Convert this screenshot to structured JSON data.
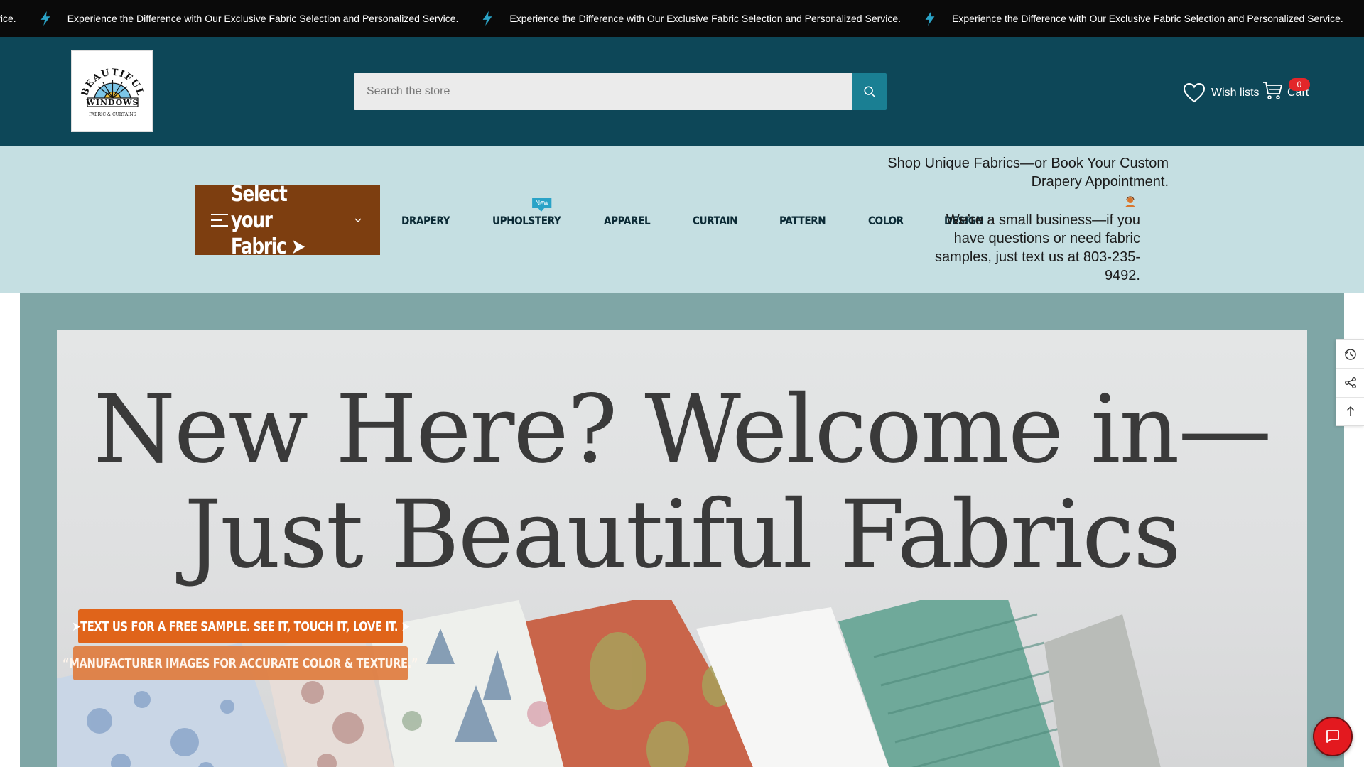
{
  "announcement": {
    "items": [
      "Experience the Difference with Our Exclusive Fabric Selection and Personalized Service.",
      "Experience the Difference with Our Exclusive Fabric Selection and Personalized Service.",
      "Experience the Difference with Our Exclusive Fabric Selection and Personalized Service.",
      "Experience the Difference with Our Exclusive Fabric Selection and Personalized Service."
    ],
    "icon": "lightning-bolt-icon",
    "icon_color": "#2aa3c7"
  },
  "header": {
    "logo": {
      "line1": "BEAUTIFUL",
      "line2": "WINDOWS",
      "line3": "FABRIC & CURTAINS"
    },
    "search": {
      "placeholder": "Search the store"
    },
    "wishlist_label": "Wish lists",
    "cart": {
      "label": "Cart",
      "count": "0"
    },
    "colors": {
      "background": "#0d4758",
      "search_button": "#1a7f93",
      "cart_badge": "#e3262a"
    }
  },
  "nav": {
    "select_fabric_label": "Select your Fabric ➤",
    "new_badge": "New",
    "items": [
      "DRAPERY",
      "UPHOLSTERY",
      "APPAREL",
      "CURTAIN",
      "PATTERN",
      "COLOR",
      "DESIGN"
    ],
    "promo": "Shop Unique Fabrics—or Book Your Custom Drapery Appointment.",
    "support": "We’re a small business—if you have questions or need fabric samples, just text us at 803-235-9492.",
    "colors": {
      "background": "#c5dfe2",
      "select_button": "#7d3e10"
    }
  },
  "hero": {
    "title": "New Here? Welcome in—Just Beautiful Fabrics",
    "cta_primary": "➤TEXT US FOR A FREE SAMPLE. SEE IT, TOUCH IT, LOVE IT. ➤",
    "cta_secondary": "“MANUFACTURER IMAGES FOR ACCURATE COLOR & TEXTURE.”",
    "colors": {
      "frame": "#7fa6a6",
      "cta": "#e0641a"
    }
  },
  "side_tools": [
    "history-icon",
    "share-icon",
    "back-to-top-icon"
  ],
  "chat": {
    "icon": "chat-icon",
    "color": "#e3191f"
  }
}
